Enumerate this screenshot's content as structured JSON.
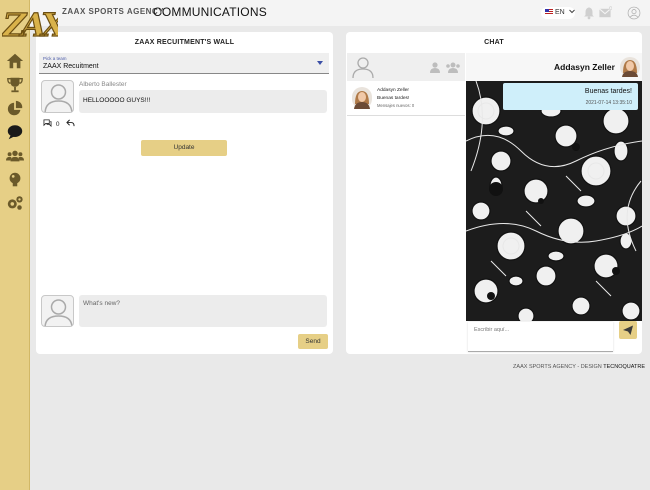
{
  "app": {
    "logo_text": "ZAX",
    "agency_name": "ZAAX SPORTS AGENCY",
    "page_title": "COMMUNICATIONS"
  },
  "header": {
    "language": "EN",
    "icons": [
      "bell-icon",
      "mail-icon",
      "user-icon"
    ]
  },
  "sidebar": {
    "items": [
      {
        "icon": "home-icon"
      },
      {
        "icon": "trophy-icon"
      },
      {
        "icon": "pie-chart-icon"
      },
      {
        "icon": "chat-bubble-icon"
      },
      {
        "icon": "users-icon"
      },
      {
        "icon": "lightbulb-icon"
      },
      {
        "icon": "gears-icon"
      }
    ]
  },
  "wall": {
    "title": "ZAAX RECUITMENT'S WALL",
    "team_label": "Pick a team",
    "team_value": "ZAAX Recuitment",
    "post": {
      "author": "Alberto Ballester",
      "message": "HELLOOOOO GUYS!!!",
      "comments": "0"
    },
    "update_label": "Update",
    "new_post_placeholder": "What's new?",
    "send_label": "Send"
  },
  "chat": {
    "title": "CHAT",
    "contact": {
      "name": "Addasyn Zeller",
      "last_message": "Buenas tardes!",
      "new_messages": "Mensajes nuevos: 0"
    },
    "active_user": "Addasyn Zeller",
    "message": {
      "text": "Buenas tardes!",
      "time": "2021-07-14 13:35:10"
    },
    "input_placeholder": "Escribir aquí..."
  },
  "footer": {
    "text": "ZAAX SPORTS AGENCY - DESIGN",
    "brand": "TECNOQUATRE"
  },
  "colors": {
    "accent": "#e6cf86",
    "chat_bubble": "#cfeffa",
    "link_blue": "#3b4fa6"
  }
}
